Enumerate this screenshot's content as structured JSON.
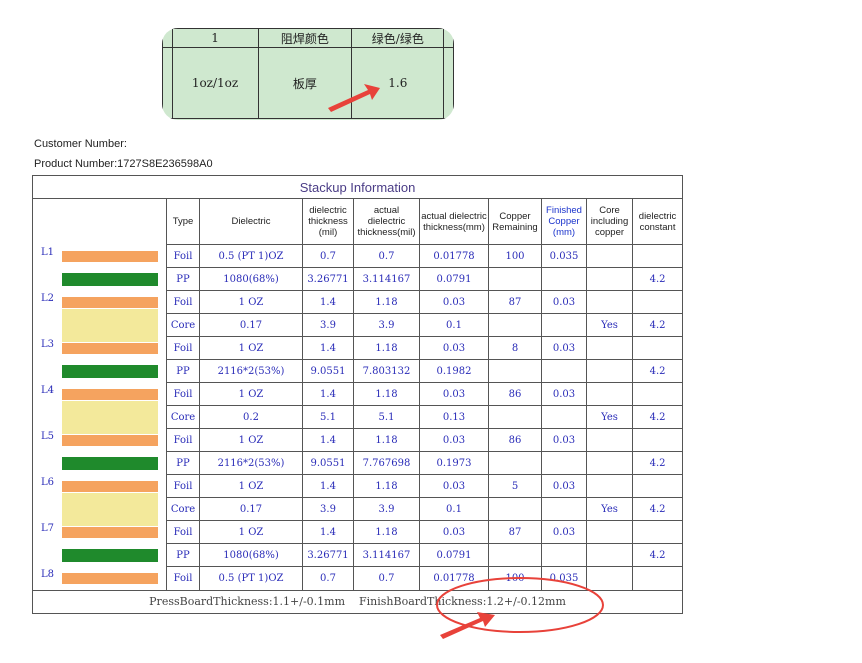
{
  "top_snippet": {
    "row1": [
      "1",
      "阻焊颜色",
      "绿色/绿色"
    ],
    "row2": [
      "1oz/1oz",
      "板厚",
      "1.6"
    ]
  },
  "meta": {
    "customer_label": "Customer Number:",
    "product_label": "Product Number:1727S8E236598A0"
  },
  "stackup": {
    "title": "Stackup Information",
    "headers": [
      "Type",
      "Dielectric",
      "dielectric thickness (mil)",
      "actual dielectric thickness(mil)",
      "actual dielectric thickness(mm)",
      "Copper Remaining",
      "Finished Copper (mm)",
      "Core including copper",
      "dielectric constant"
    ],
    "layer_labels": [
      "L1",
      "L2",
      "L3",
      "L4",
      "L5",
      "L6",
      "L7",
      "L8"
    ],
    "rows": [
      {
        "type": "Foil",
        "dielectric": "0.5 (PT 1)OZ",
        "thick_mil": "0.7",
        "act_mil": "0.7",
        "act_mm": "0.01778",
        "copper": "100",
        "finished": "0.035",
        "core": "",
        "dk": ""
      },
      {
        "type": "PP",
        "dielectric": "1080(68%)",
        "thick_mil": "3.26771",
        "act_mil": "3.114167",
        "act_mm": "0.0791",
        "copper": "",
        "finished": "",
        "core": "",
        "dk": "4.2"
      },
      {
        "type": "Foil",
        "dielectric": "1 OZ",
        "thick_mil": "1.4",
        "act_mil": "1.18",
        "act_mm": "0.03",
        "copper": "87",
        "finished": "0.03",
        "core": "",
        "dk": ""
      },
      {
        "type": "Core",
        "dielectric": "0.17",
        "thick_mil": "3.9",
        "act_mil": "3.9",
        "act_mm": "0.1",
        "copper": "",
        "finished": "",
        "core": "Yes",
        "dk": "4.2"
      },
      {
        "type": "Foil",
        "dielectric": "1 OZ",
        "thick_mil": "1.4",
        "act_mil": "1.18",
        "act_mm": "0.03",
        "copper": "8",
        "finished": "0.03",
        "core": "",
        "dk": ""
      },
      {
        "type": "PP",
        "dielectric": "2116*2(53%)",
        "thick_mil": "9.0551",
        "act_mil": "7.803132",
        "act_mm": "0.1982",
        "copper": "",
        "finished": "",
        "core": "",
        "dk": "4.2"
      },
      {
        "type": "Foil",
        "dielectric": "1 OZ",
        "thick_mil": "1.4",
        "act_mil": "1.18",
        "act_mm": "0.03",
        "copper": "86",
        "finished": "0.03",
        "core": "",
        "dk": ""
      },
      {
        "type": "Core",
        "dielectric": "0.2",
        "thick_mil": "5.1",
        "act_mil": "5.1",
        "act_mm": "0.13",
        "copper": "",
        "finished": "",
        "core": "Yes",
        "dk": "4.2"
      },
      {
        "type": "Foil",
        "dielectric": "1 OZ",
        "thick_mil": "1.4",
        "act_mil": "1.18",
        "act_mm": "0.03",
        "copper": "86",
        "finished": "0.03",
        "core": "",
        "dk": ""
      },
      {
        "type": "PP",
        "dielectric": "2116*2(53%)",
        "thick_mil": "9.0551",
        "act_mil": "7.767698",
        "act_mm": "0.1973",
        "copper": "",
        "finished": "",
        "core": "",
        "dk": "4.2"
      },
      {
        "type": "Foil",
        "dielectric": "1 OZ",
        "thick_mil": "1.4",
        "act_mil": "1.18",
        "act_mm": "0.03",
        "copper": "5",
        "finished": "0.03",
        "core": "",
        "dk": ""
      },
      {
        "type": "Core",
        "dielectric": "0.17",
        "thick_mil": "3.9",
        "act_mil": "3.9",
        "act_mm": "0.1",
        "copper": "",
        "finished": "",
        "core": "Yes",
        "dk": "4.2"
      },
      {
        "type": "Foil",
        "dielectric": "1 OZ",
        "thick_mil": "1.4",
        "act_mil": "1.18",
        "act_mm": "0.03",
        "copper": "87",
        "finished": "0.03",
        "core": "",
        "dk": ""
      },
      {
        "type": "PP",
        "dielectric": "1080(68%)",
        "thick_mil": "3.26771",
        "act_mil": "3.114167",
        "act_mm": "0.0791",
        "copper": "",
        "finished": "",
        "core": "",
        "dk": "4.2"
      },
      {
        "type": "Foil",
        "dielectric": "0.5 (PT 1)OZ",
        "thick_mil": "0.7",
        "act_mil": "0.7",
        "act_mm": "0.01778",
        "copper": "100",
        "finished": "0.035",
        "core": "",
        "dk": ""
      }
    ],
    "footer": "PressBoardThickness:1.1+/-0.1mm    FinishBoardThickness:1.2+/-0.12mm"
  },
  "colors": {
    "copper": "#f5a35f",
    "prepreg": "#1f8a2c",
    "core": "#f3e99b",
    "annotation_red": "#e8423a",
    "snippet_bg": "#cfe8cf"
  }
}
